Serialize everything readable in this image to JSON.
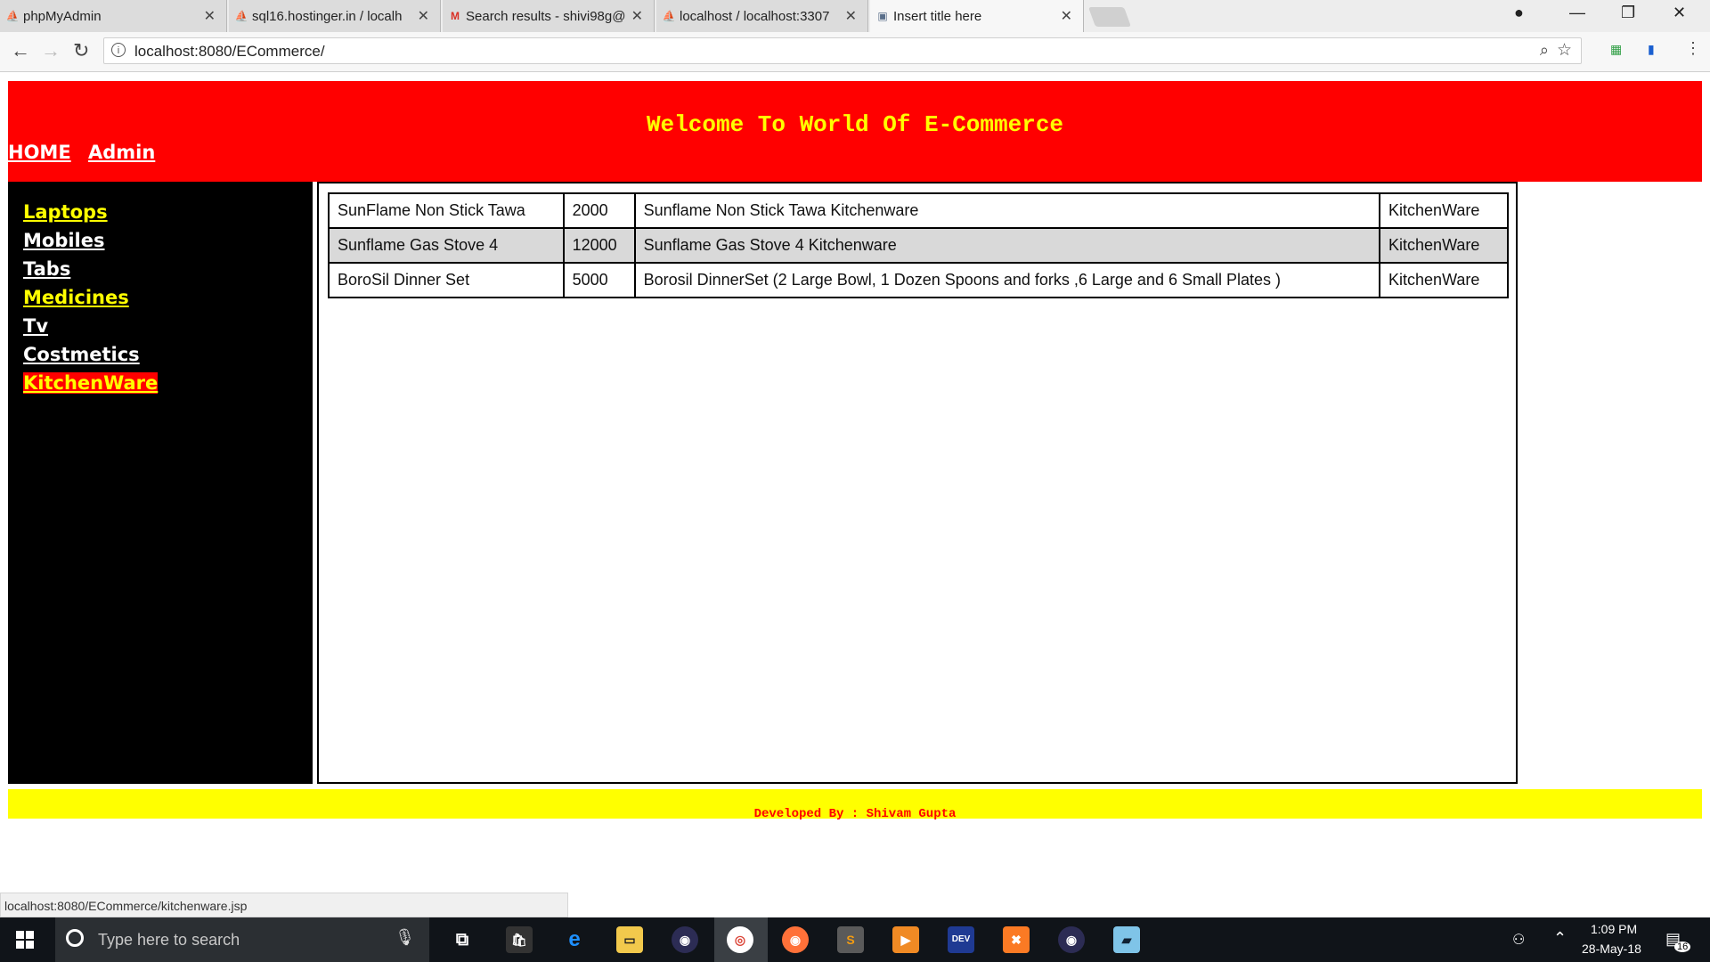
{
  "browser": {
    "tabs": [
      {
        "title": "phpMyAdmin",
        "icon": "phpmyadmin-icon",
        "fav": "⛵",
        "favcolor": "#6b5fb5"
      },
      {
        "title": "sql16.hostinger.in / localh",
        "icon": "phpmyadmin-pma-icon",
        "fav": "⛵",
        "favcolor": "#f29111"
      },
      {
        "title": "Search results - shivi98g@",
        "icon": "gmail-icon",
        "fav": "M",
        "favcolor": "#d93025"
      },
      {
        "title": "localhost / localhost:3307",
        "icon": "phpmyadmin-pma-icon",
        "fav": "⛵",
        "favcolor": "#f29111"
      },
      {
        "title": "Insert title here",
        "icon": "page-icon",
        "fav": "▣",
        "favcolor": "#5a6f8a"
      }
    ],
    "address": "localhost:8080/ECommerce/",
    "status_url": "localhost:8080/ECommerce/kitchenware.jsp"
  },
  "page": {
    "header_title": "Welcome To World Of E-Commerce",
    "nav": [
      "HOME",
      "Admin"
    ],
    "sidebar": [
      {
        "label": "Laptops",
        "style": "yellow"
      },
      {
        "label": "Mobiles",
        "style": "white"
      },
      {
        "label": "Tabs",
        "style": "white"
      },
      {
        "label": "Medicines",
        "style": "yellow"
      },
      {
        "label": "Tv",
        "style": "white"
      },
      {
        "label": "Costmetics",
        "style": "white"
      },
      {
        "label": "KitchenWare",
        "style": "active"
      }
    ],
    "products": [
      [
        "SunFlame Non Stick Tawa",
        "2000",
        "Sunflame Non Stick Tawa Kitchenware",
        "KitchenWare"
      ],
      [
        "Sunflame Gas Stove 4",
        "12000",
        "Sunflame Gas Stove 4 Kitchenware",
        "KitchenWare"
      ],
      [
        "BoroSil Dinner Set",
        "5000",
        "Borosil DinnerSet (2 Large Bowl, 1 Dozen Spoons and forks ,6 Large and 6 Small Plates )",
        "KitchenWare"
      ]
    ],
    "footer": "Developed By : Shivam Gupta"
  },
  "taskbar": {
    "search_placeholder": "Type here to search",
    "time": "1:09 PM",
    "date": "28-May-18",
    "notifications": "16"
  },
  "colors": {
    "header_bg": "#ff0000",
    "header_text": "#ffff00",
    "sidebar_bg": "#000000",
    "footer_bg": "#ffff00",
    "footer_text": "#ff0000"
  }
}
